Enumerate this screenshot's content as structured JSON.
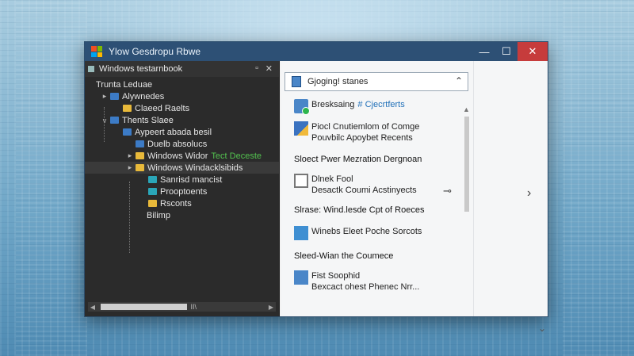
{
  "window": {
    "title": "Ylow Gesdropu Rbwe",
    "controls": {
      "minimize": "—",
      "maximize": "☐",
      "close": "✕"
    }
  },
  "tree": {
    "header": "Windows testarnbook",
    "pin": "▫",
    "close": "✕",
    "nodes": [
      {
        "label": "Trunta Leduae",
        "indent": 0,
        "arrow": "",
        "icon": "none"
      },
      {
        "label": "Alywnedes",
        "indent": 1,
        "arrow": "▸",
        "icon": "blue"
      },
      {
        "label": "Claeed Raelts",
        "indent": 2,
        "arrow": "",
        "icon": "yellow"
      },
      {
        "label": "Thents Slaee",
        "indent": 1,
        "arrow": "v",
        "icon": "blue"
      },
      {
        "label": "Aypeert abada besil",
        "indent": 2,
        "arrow": "",
        "icon": "blue"
      },
      {
        "label": "Duelb absolucs",
        "indent": 3,
        "arrow": "",
        "icon": "blue"
      },
      {
        "label": "Windows Widor",
        "green": "Tect Deceste",
        "indent": 3,
        "arrow": "▸",
        "icon": "yellow"
      },
      {
        "label": "Windows Windacklsibids",
        "indent": 3,
        "arrow": "▸",
        "icon": "yellow",
        "selected": true
      },
      {
        "label": "Sanrisd mancist",
        "indent": 4,
        "arrow": "",
        "icon": "teal"
      },
      {
        "label": "Prooptoents",
        "indent": 4,
        "arrow": "",
        "icon": "teal"
      },
      {
        "label": "Rsconts",
        "indent": 4,
        "arrow": "",
        "icon": "yellow"
      },
      {
        "label": "Bilimp",
        "indent": 4,
        "arrow": "",
        "icon": "none"
      }
    ],
    "hscroll_mid": "II\\"
  },
  "right": {
    "dropdown": "Gjoging! stanes",
    "items": [
      {
        "title": "Bresksaing",
        "accent": "# Cjecrtferts",
        "icon": "shield"
      },
      {
        "title": "Piocl Cnutiemlom of Comge",
        "sub": "Pouvbilc Apoybet Recents",
        "icon": "doc"
      },
      {
        "section": "Sloect Pwer Mezration Dergnoan"
      },
      {
        "title": "Dlnek Fool",
        "sub": "Desactk Coumi Acstinyects",
        "icon": "frame"
      },
      {
        "section": "Slrase: Wind.lesde Cpt of Roeces"
      },
      {
        "title": "Winebs Eleet Poche Sorcots",
        "icon": "chart"
      },
      {
        "section": "Sleed-Wian the Coumece"
      },
      {
        "title": "Fist Soophid",
        "sub": "Bexcact ohest Phenec Nrr...",
        "icon": "file"
      }
    ],
    "key_glyph": "⊸",
    "chevron_right": "›",
    "chevron_down": "⌄",
    "dropdown_chev": "⌃"
  }
}
